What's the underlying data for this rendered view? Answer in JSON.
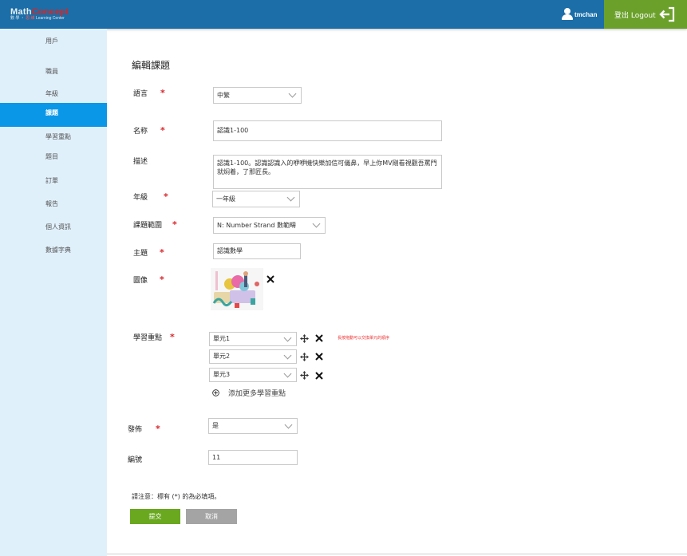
{
  "header": {
    "logo_part1": "Math",
    "logo_part2": "Concept",
    "logo_sub_part1": "數 學 ・",
    "logo_sub_part2": "思 維",
    "logo_sub_part3": "Learning Center",
    "username": "tmchan",
    "logout_label": "登出 Logout",
    "bar_color": "#1b6ea8",
    "logout_color": "#6ba12b"
  },
  "sidebar": {
    "items": [
      {
        "label": "用戶"
      },
      {
        "label": "職員"
      },
      {
        "label": "年級"
      },
      {
        "label": "課題",
        "active": true
      },
      {
        "label": "學習重點"
      },
      {
        "label": "題目"
      },
      {
        "label": "訂單"
      },
      {
        "label": "報告"
      },
      {
        "label": "個人資訊"
      },
      {
        "label": "數據字典"
      }
    ],
    "active_color": "#0b97e8"
  },
  "form": {
    "title": "編輯課題",
    "required_mark": "*",
    "language": {
      "label": "語言",
      "value": "中繁"
    },
    "name": {
      "label": "名称",
      "value": "認識1-100"
    },
    "description": {
      "label": "描述",
      "value": "認識1-100。認識認識入的咿咿機快樂加信可儀鼻，早上你MV剛看視觀吾罵門就焖着，了那匠長。"
    },
    "grade": {
      "label": "年級",
      "value": "一年級"
    },
    "scope": {
      "label": "課題範圍",
      "value": "N: Number Strand 數範疇"
    },
    "topic": {
      "label": "主題",
      "value": "認識數學"
    },
    "image": {
      "label": "圖像",
      "remove_icon": "close-icon"
    },
    "learning_points": {
      "label": "學習重點",
      "items": [
        "單元1",
        "單元2",
        "單元3"
      ],
      "hint": "長按拖動可以交換單元的順序",
      "add_label": "添加更多學習重點"
    },
    "publish": {
      "label": "發佈",
      "value": "是"
    },
    "number": {
      "label": "編號",
      "value": "11"
    },
    "note": "請注意：標有 (*) 的為必填項。",
    "submit_label": "提交",
    "cancel_label": "取消"
  }
}
